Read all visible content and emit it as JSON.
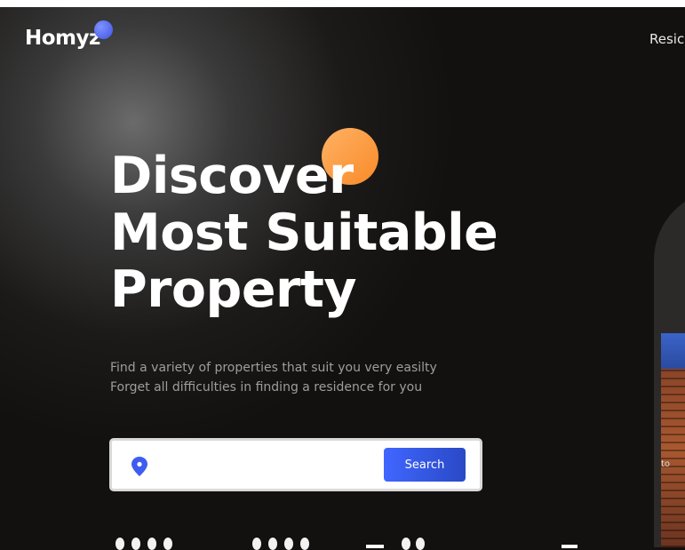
{
  "header": {
    "logo": "Homyz",
    "nav_link": "Resic"
  },
  "hero": {
    "title_lines": [
      "Discover",
      "Most Suitable",
      "Property"
    ],
    "subtitle_lines": [
      "Find a variety of properties that suit you very easilty",
      "Forget all difficulties in finding a residence for you"
    ],
    "image_caption": "to"
  },
  "search": {
    "button_label": "Search",
    "input_value": "",
    "placeholder": ""
  },
  "icons": {
    "location": "location-pin-icon"
  },
  "colors": {
    "accent_blue": "#4066ff",
    "accent_orange": "#f98a27",
    "background": "#131110"
  }
}
